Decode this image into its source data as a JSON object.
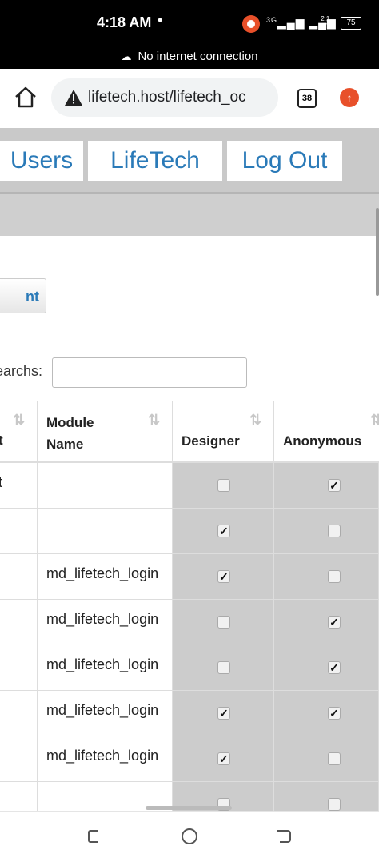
{
  "status_bar": {
    "time": "4:18 AM",
    "dot": "•",
    "network": "3G",
    "speed_value": "2.1",
    "speed_unit": "K/s",
    "battery": "75",
    "connection_notice": "No internet connection"
  },
  "browser": {
    "url": "lifetech.host/lifetech_oc",
    "tab_count": "38"
  },
  "nav": {
    "users_label": "Users",
    "lifetech_label": "LifeTech",
    "logout_label": "Log Out"
  },
  "action_button_label": "nt",
  "search": {
    "label": "earchs:",
    "value": ""
  },
  "table": {
    "headers": {
      "col1": "t",
      "module_name": "Module Name",
      "module_line1": "Module",
      "module_line2": "Name",
      "designer": "Designer",
      "anonymous": "Anonymous"
    },
    "rows": [
      {
        "col1": "t",
        "module": "",
        "designer": false,
        "anonymous": true
      },
      {
        "col1": "",
        "module": "",
        "designer": true,
        "anonymous": false
      },
      {
        "col1": "",
        "module": "md_lifetech_login",
        "designer": true,
        "anonymous": false
      },
      {
        "col1": "",
        "module": "md_lifetech_login",
        "designer": false,
        "anonymous": true
      },
      {
        "col1": "",
        "module": "md_lifetech_login",
        "designer": false,
        "anonymous": true
      },
      {
        "col1": "",
        "module": "md_lifetech_login",
        "designer": true,
        "anonymous": true
      },
      {
        "col1": "",
        "module": "md_lifetech_login",
        "designer": true,
        "anonymous": false
      },
      {
        "col1": "",
        "module": "",
        "designer": false,
        "anonymous": false
      }
    ]
  }
}
